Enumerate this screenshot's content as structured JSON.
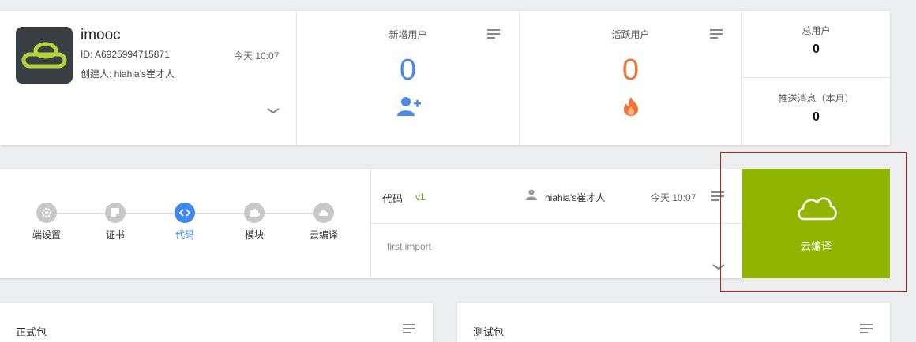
{
  "app": {
    "name": "imooc",
    "id_text": "ID: A6925994715871",
    "time": "今天 10:07",
    "creator": "创建人: hiahia's崔才人"
  },
  "stats": {
    "new_users": {
      "label": "新增用户",
      "value": "0",
      "icon": "add-user-icon",
      "color": "#4a8ae8"
    },
    "active_users": {
      "label": "活跃用户",
      "value": "0",
      "icon": "fire-icon",
      "color": "#f07238"
    }
  },
  "totals": {
    "total_users_label": "总用户",
    "total_users_value": "0",
    "push_label": "推送消息（本月）",
    "push_value": "0"
  },
  "steps": [
    {
      "label": "端设置",
      "icon": "gear-icon",
      "active": false
    },
    {
      "label": "证书",
      "icon": "certificate-icon",
      "active": false
    },
    {
      "label": "代码",
      "icon": "code-icon",
      "active": true
    },
    {
      "label": "模块",
      "icon": "puzzle-icon",
      "active": false
    },
    {
      "label": "云编译",
      "icon": "cloud-icon",
      "active": false
    }
  ],
  "code": {
    "title": "代码",
    "version": "v1",
    "user": "hiahia's崔才人",
    "time": "今天 10:07",
    "message": "first import"
  },
  "cloud_build": {
    "label": "云编译",
    "color": "#8fb500"
  },
  "packages": {
    "release_title": "正式包",
    "test_title": "测试包"
  }
}
